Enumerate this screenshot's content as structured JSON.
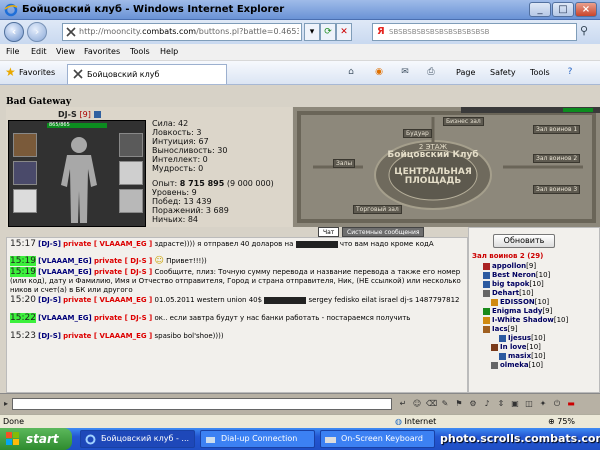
{
  "window": {
    "title": "Бойцовский клуб - Windows Internet Explorer"
  },
  "address": {
    "url_prefix": "http://mooncity.",
    "url_domain": "combats.com",
    "url_suffix": "/buttons.pl?battle=0.46530131...",
    "search_placeholder": "SBSBSBSBSBSBSBSBSBSBSB"
  },
  "menu": [
    "File",
    "Edit",
    "View",
    "Favorites",
    "Tools",
    "Help"
  ],
  "favorites": {
    "label": "Favorites",
    "tab_title": "Бойцовский клуб"
  },
  "commandbar": {
    "page": "Page",
    "safety": "Safety",
    "tools": "Tools"
  },
  "content": {
    "error": "Bad Gateway",
    "character": {
      "name": "DJ-S",
      "level": "[9]",
      "hp": "865/865",
      "stats": [
        "Сила: 42",
        "Ловкость: 3",
        "Интуиция: 67",
        "Выносливость: 30",
        "Интеллект: 0",
        "Мудрость: 0"
      ],
      "exp_label": "Опыт:",
      "exp_value": "8 715 895",
      "exp_next": "(9 000 000)",
      "level_line": "Уровень: 9",
      "wins": "Побед: 13 439",
      "losses": "Поражений: 3 689",
      "draws": "Ничьих: 84"
    },
    "map": {
      "labels": [
        "Бизнес зал",
        "Зал воинов 1",
        "Залы",
        "Зал воинов 2",
        "Зал воинов 3",
        "Будуар",
        "Торговый зал"
      ],
      "center_top": "2 ЭТАЖ",
      "center_name": "Бойцовский Клуб",
      "center_bottom1": "ЦЕНТРАЛЬНАЯ",
      "center_bottom2": "ПЛОЩАДЬ"
    },
    "chat_tabs": {
      "chat": "Чат",
      "system": "Системные сообщения"
    },
    "chat": [
      {
        "time": "15:17",
        "hl": false,
        "from": "[DJ-S]",
        "priv": "private [ VLAAAM_EG ]",
        "text": "здрасте)))) я отправел 40 доларов на",
        "text2": "что вам надо кроме кодА"
      },
      {
        "time": "15:19",
        "hl": true,
        "from": "[VLAAAM_EG]",
        "priv": "private [ DJ-S ]",
        "text": "Привет!!!))"
      },
      {
        "time": "15:19",
        "hl": true,
        "from": "[VLAAAM_EG]",
        "priv": "private [ DJ-S ]",
        "text": "Сообщите, плиз: Точную сумму перевода и название перевода а также его номер (или код), дату и Фамилию, Имя и Отчество отправителя, Город и страна отправителя, Ник, (НЕ ссылкой) или несколько ников и счет(а) в БК или другого"
      },
      {
        "time": "15:20",
        "hl": false,
        "from": "[DJ-S]",
        "priv": "private [ VLAAAM_EG ]",
        "text": "01.05.2011 western union 40$",
        "text2": "sergey fedisko eilat israel dj-s 1487797812"
      },
      {
        "time": "15:22",
        "hl": true,
        "from": "[VLAAAM_EG]",
        "priv": "private [ DJ-S ]",
        "text": "ок.. если завтра будут у нас банки работать - постараемся получить"
      },
      {
        "time": "15:23",
        "hl": false,
        "from": "[DJ-S]",
        "priv": "private [ VLAAAM_EG ]",
        "text": "spasibo bol'shoe))))"
      }
    ],
    "online": {
      "refresh": "Обновить",
      "title": "Зал воинов 2 (29)",
      "users": [
        {
          "name": "appollon",
          "lvl": "[9]"
        },
        {
          "name": "Best Neron",
          "lvl": "[10]"
        },
        {
          "name": "big tapok",
          "lvl": "[10]"
        },
        {
          "name": "Dehart",
          "lvl": "[10]"
        },
        {
          "name": "EDISSON",
          "lvl": "[10]"
        },
        {
          "name": "Enigma Lady",
          "lvl": "[9]"
        },
        {
          "name": "I-White Shadow",
          "lvl": "[10]"
        },
        {
          "name": "Iacs",
          "lvl": "[9]"
        },
        {
          "name": "Ijesus",
          "lvl": "[10]"
        },
        {
          "name": "In love",
          "lvl": "[10]"
        },
        {
          "name": "masix",
          "lvl": "[10]"
        },
        {
          "name": "olmeka",
          "lvl": "[10]"
        }
      ]
    }
  },
  "status": {
    "text": "Done",
    "zone": "Internet",
    "zoom": "75%"
  },
  "taskbar": {
    "start": "start",
    "tasks": [
      "Бойцовский клуб - ...",
      "Dial-up Connection",
      "On-Screen Keyboard"
    ],
    "watermark": "photo.scrolls.combats.com"
  },
  "colors": {
    "highlight": "#3cf03c",
    "private": "#dd0000",
    "nick": "#00007a"
  }
}
